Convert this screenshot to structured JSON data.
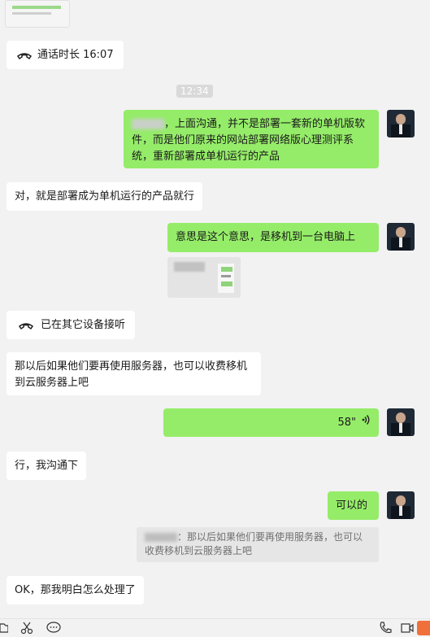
{
  "messages": {
    "call_duration": {
      "icon": "phone-hangup-icon",
      "text": "通话时长 16:07"
    },
    "timestamp": "12:34",
    "m1_text": "，上面沟通，并不是部署一套新的单机版软件，而是他们原来的网站部署网络版心理测评系统，重新部署成单机运行的产品",
    "m2_text": "对，就是部署成为单机运行的产品就行",
    "m3_text": "意思是这个意思，是移机到一台电脑上",
    "other_device": {
      "icon": "phone-hangup-icon",
      "text": "已在其它设备接听"
    },
    "m4_text": "那以后如果他们要再使用服务器，也可以收费移机到云服务器上吧",
    "voice": {
      "duration": "58\"",
      "icon": "voice-wave-icon"
    },
    "m5_text": "行，我沟通下",
    "m6_text": "可以的",
    "quote_text": "：那以后如果他们要再使用服务器，也可以收费移机到云服务器上吧",
    "m7_text": "OK，那我明白怎么处理了"
  },
  "toolbar": {
    "icons": [
      "folder-icon",
      "scissors-icon",
      "chat-bubble-icon",
      "phone-icon",
      "video-icon"
    ]
  },
  "colors": {
    "background": "#f2f2f2",
    "bubble_self": "#95ec69",
    "bubble_other": "#ffffff",
    "quote_bg": "#e6e6e6"
  }
}
